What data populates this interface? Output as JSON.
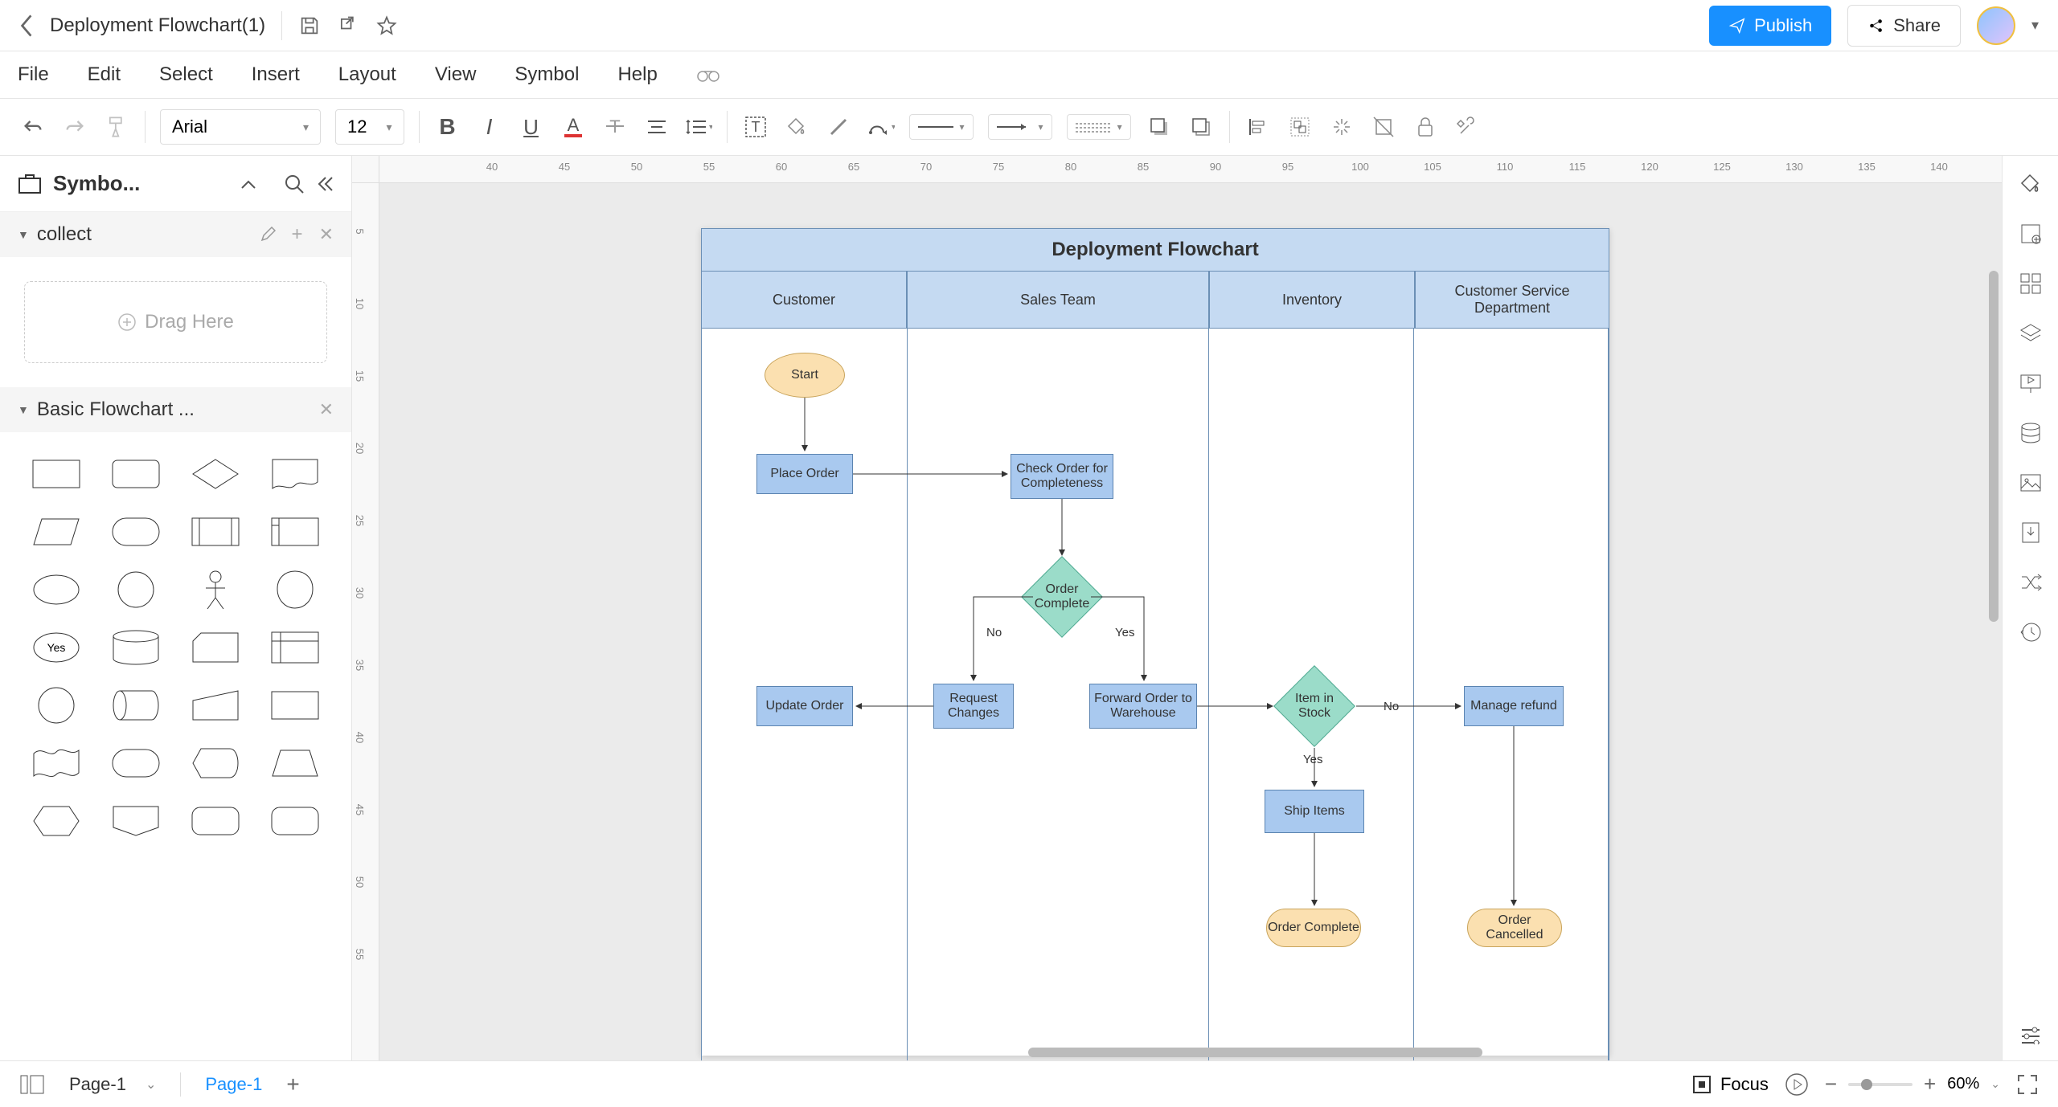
{
  "doc": {
    "name": "Deployment Flowchart(1)"
  },
  "menu": {
    "file": "File",
    "edit": "Edit",
    "select": "Select",
    "insert": "Insert",
    "layout": "Layout",
    "view": "View",
    "symbol": "Symbol",
    "help": "Help"
  },
  "toolbar": {
    "font": "Arial",
    "size": "12"
  },
  "buttons": {
    "publish": "Publish",
    "share": "Share"
  },
  "leftpanel": {
    "title": "Symbo...",
    "collect": "collect",
    "drag_here": "Drag Here",
    "basic_flowchart": "Basic Flowchart ..."
  },
  "ruler_h": [
    "40",
    "45",
    "50",
    "55",
    "60",
    "65",
    "70",
    "75",
    "80",
    "85",
    "90",
    "95",
    "100",
    "105",
    "110",
    "115",
    "120",
    "125",
    "130",
    "135",
    "140"
  ],
  "ruler_v": [
    "5",
    "10",
    "15",
    "20",
    "25",
    "30",
    "35",
    "40",
    "45",
    "50",
    "55"
  ],
  "diagram": {
    "title": "Deployment Flowchart",
    "lanes": [
      "Customer",
      "Sales Team",
      "Inventory",
      "Customer Service Department"
    ],
    "nodes": {
      "start": "Start",
      "place_order": "Place Order",
      "check_order": "Check Order for Completeness",
      "order_complete": "Order Complete",
      "request_changes": "Request Changes",
      "update_order": "Update Order",
      "forward_order": "Forward Order to Warehouse",
      "item_in_stock": "Item in Stock",
      "ship_items": "Ship Items",
      "order_complete_end": "Order Complete",
      "manage_refund": "Manage refund",
      "order_cancelled": "Order Cancelled"
    },
    "edge_labels": {
      "no1": "No",
      "yes1": "Yes",
      "no2": "No",
      "yes2": "Yes"
    }
  },
  "bottom": {
    "page_sel": "Page-1",
    "tab": "Page-1",
    "focus": "Focus",
    "zoom": "60%"
  },
  "shape_yes": "Yes"
}
